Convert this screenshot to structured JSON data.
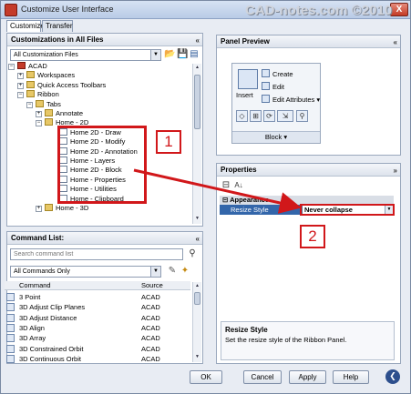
{
  "window": {
    "title": "Customize User Interface",
    "close_label": "X"
  },
  "watermark": "CAD-notes.com ©2010",
  "tabs": [
    {
      "label": "Customize"
    },
    {
      "label": "Transfer"
    }
  ],
  "customizations_panel": {
    "title": "Customizations in All Files",
    "collapse": "«",
    "filter_value": "All Customization Files",
    "tree": [
      {
        "label": "ACAD",
        "icon": "acad-icon",
        "expander": "−"
      },
      {
        "label": "Workspaces",
        "icon": "folder-icon",
        "expander": "+"
      },
      {
        "label": "Quick Access Toolbars",
        "icon": "folder-icon",
        "expander": "+"
      },
      {
        "label": "Ribbon",
        "icon": "folder-icon",
        "expander": "−"
      },
      {
        "label": "Tabs",
        "icon": "folder-icon",
        "expander": "−"
      },
      {
        "label": "Annotate",
        "icon": "folder-icon",
        "expander": "+"
      },
      {
        "label": "Home - 2D",
        "icon": "folder-icon",
        "expander": "−"
      },
      {
        "label": "Home 2D - Draw",
        "icon": "panel-icon",
        "expander": ""
      },
      {
        "label": "Home 2D - Modify",
        "icon": "panel-icon",
        "expander": ""
      },
      {
        "label": "Home 2D - Annotation",
        "icon": "panel-icon",
        "expander": ""
      },
      {
        "label": "Home - Layers",
        "icon": "panel-icon",
        "expander": ""
      },
      {
        "label": "Home 2D - Block",
        "icon": "panel-icon",
        "expander": ""
      },
      {
        "label": "Home - Properties",
        "icon": "panel-icon",
        "expander": ""
      },
      {
        "label": "Home - Utilities",
        "icon": "panel-icon",
        "expander": ""
      },
      {
        "label": "Home - Clipboard",
        "icon": "panel-icon",
        "expander": ""
      },
      {
        "label": "Home - 3D",
        "icon": "folder-icon",
        "expander": "+"
      }
    ]
  },
  "command_list": {
    "title": "Command List:",
    "collapse": "«",
    "search_placeholder": "Search command list",
    "filter_value": "All Commands Only",
    "columns": {
      "command": "Command",
      "source": "Source"
    },
    "rows": [
      {
        "command": "3 Point",
        "source": "ACAD"
      },
      {
        "command": "3D Adjust Clip Planes",
        "source": "ACAD"
      },
      {
        "command": "3D Adjust Distance",
        "source": "ACAD"
      },
      {
        "command": "3D Align",
        "source": "ACAD"
      },
      {
        "command": "3D Array",
        "source": "ACAD"
      },
      {
        "command": "3D Constrained Orbit",
        "source": "ACAD"
      },
      {
        "command": "3D Continuous Orbit",
        "source": "ACAD"
      }
    ]
  },
  "panel_preview": {
    "title": "Panel Preview",
    "collapse": "«",
    "insert_label": "Insert",
    "create_label": "Create",
    "edit_label": "Edit",
    "edit_attributes_label": "Edit Attributes",
    "panel_label": "Block"
  },
  "properties": {
    "title": "Properties",
    "collapse": "»",
    "category": "Appearance",
    "row_name": "Resize Style",
    "row_value": "Never collapse",
    "description_title": "Resize Style",
    "description_text": "Set the resize style of the Ribbon Panel."
  },
  "buttons": {
    "ok": "OK",
    "cancel": "Cancel",
    "apply": "Apply",
    "help": "Help",
    "nav": "❮"
  },
  "callouts": {
    "one": "1",
    "two": "2"
  },
  "colors": {
    "callout_red": "#d1171a",
    "selection_blue": "#3366aa"
  }
}
